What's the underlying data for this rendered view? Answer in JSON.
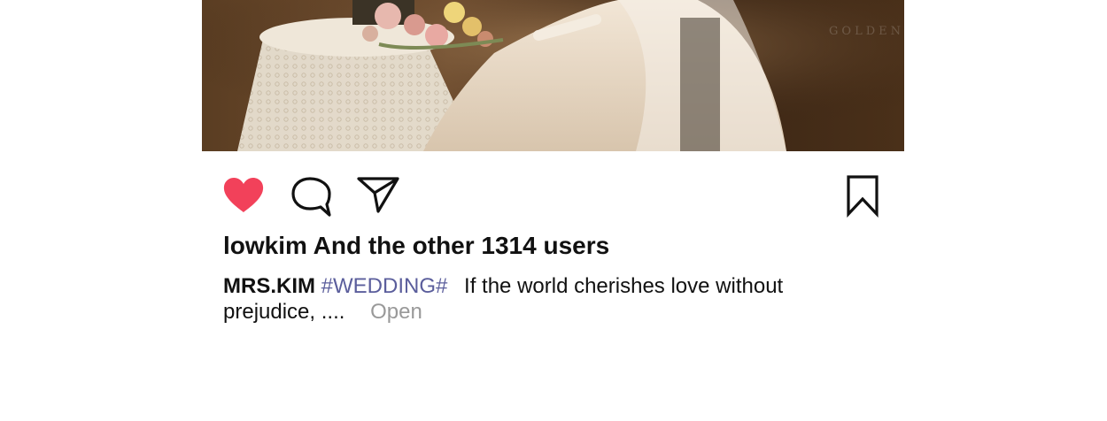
{
  "post": {
    "photo": {
      "description_icon": "wedding-photo",
      "watermark": "GOLDEN"
    },
    "actions": {
      "like_icon": "heart-filled-icon",
      "comment_icon": "comment-bubble-icon",
      "share_icon": "send-paper-plane-icon",
      "save_icon": "bookmark-icon",
      "like_color": "#f2415a"
    },
    "likes_text": "lowkim And the other 1314 users",
    "caption": {
      "username": "MRS.KIM",
      "hashtag": "#WEDDING#",
      "text": "If the world cherishes love without prejudice, ....",
      "more_label": "Open"
    }
  }
}
